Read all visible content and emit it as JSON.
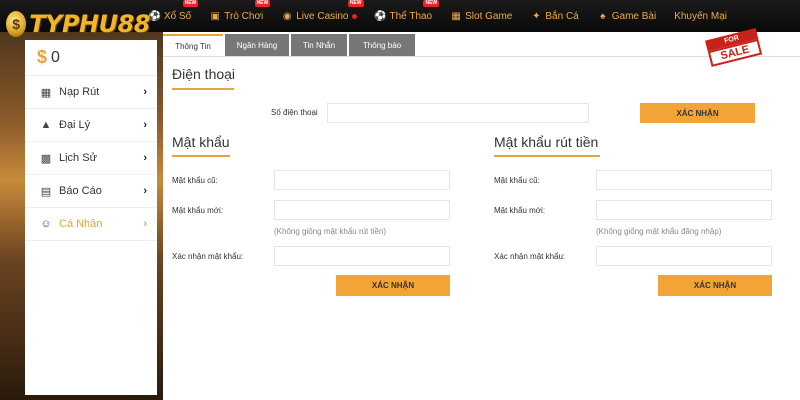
{
  "brand": {
    "name": "TYPHU88"
  },
  "nav": [
    {
      "label": "Xổ Số",
      "icon": "lottery-icon",
      "badge": "NEW"
    },
    {
      "label": "Trò Chơi",
      "icon": "gamepad-icon",
      "badge": "NEW"
    },
    {
      "label": "Live Casino",
      "icon": "live-casino-icon",
      "badge": "NEW"
    },
    {
      "label": "Thể Thao",
      "icon": "soccer-ball-icon",
      "badge": "NEW"
    },
    {
      "label": "Slot Game",
      "icon": "controller-icon",
      "badge": ""
    },
    {
      "label": "Bắn Cá",
      "icon": "fish-icon",
      "badge": ""
    },
    {
      "label": "Game Bài",
      "icon": "cards-icon",
      "badge": ""
    },
    {
      "label": "Khuyến Mại",
      "icon": "",
      "badge": ""
    }
  ],
  "sidebar": {
    "currency_symbol": "$",
    "balance": "0",
    "items": [
      {
        "label": "Nạp Rút",
        "icon": "calculator-icon"
      },
      {
        "label": "Đại Lý",
        "icon": "pyramid-icon"
      },
      {
        "label": "Lịch Sử",
        "icon": "calendar-icon"
      },
      {
        "label": "Báo Cáo",
        "icon": "report-icon"
      },
      {
        "label": "Cá Nhân",
        "icon": "user-icon",
        "active": true
      }
    ]
  },
  "tabs": [
    {
      "label": "Thông Tin",
      "active": true
    },
    {
      "label": "Ngân Hàng"
    },
    {
      "label": "Tin Nhắn"
    },
    {
      "label": "Thông báo"
    }
  ],
  "sticker": {
    "top": "FOR",
    "bottom": "SALE"
  },
  "phone_section": {
    "title": "Điện thoại",
    "phone_label": "Số điện thoại",
    "phone_value": "",
    "confirm_label": "XÁC NHẬN"
  },
  "password_section": {
    "title": "Mật khẩu",
    "old_label": "Mật khẩu cũ:",
    "new_label": "Mật khẩu mới:",
    "hint": "(Không giống mật khẩu rút tiền)",
    "confirm_field_label": "Xác nhận mật khẩu:",
    "confirm_label": "XÁC NHẬN"
  },
  "withdraw_password_section": {
    "title": "Mật khẩu rút tiền",
    "old_label": "Mật khẩu cũ:",
    "new_label": "Mật khẩu mới:",
    "hint": "(Không giống mật khẩu đăng nhập)",
    "confirm_field_label": "Xác nhận mật khẩu:",
    "confirm_label": "XÁC NHẬN"
  },
  "colors": {
    "accent": "#f2a437",
    "tab_inactive": "#777777",
    "nav_text": "#f0a94a"
  }
}
